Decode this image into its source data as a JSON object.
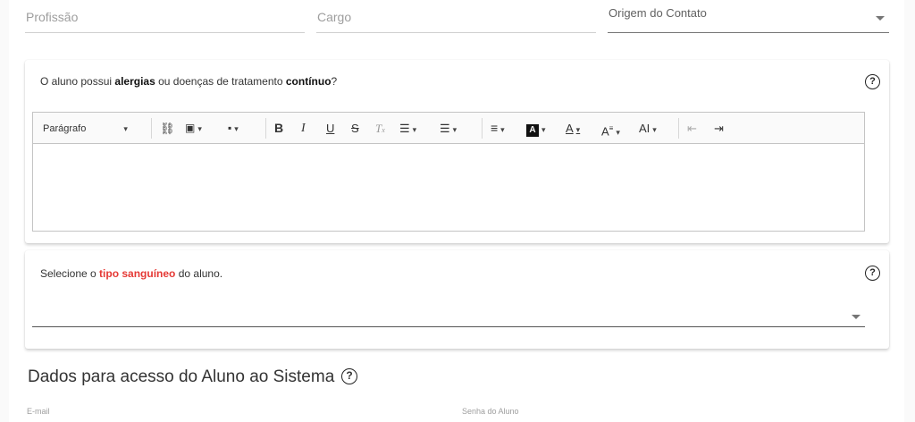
{
  "fields": {
    "profissao": "Profissão",
    "cargo": "Cargo",
    "origem": "Origem do Contato"
  },
  "allergy": {
    "text_before": "O aluno possui ",
    "bold1": "alergias",
    "text_mid": " ou doenças de tratamento ",
    "bold2": "contínuo",
    "text_after": "?",
    "help": "?"
  },
  "toolbar": {
    "paragraph": "Parágrafo",
    "items": [
      {
        "name": "link-icon",
        "glyph": "🔗"
      },
      {
        "name": "media-icon",
        "glyph": "▶"
      },
      {
        "name": "image-icon",
        "glyph": "🖼"
      },
      {
        "name": "bold-icon",
        "glyph": "B"
      },
      {
        "name": "italic-icon",
        "glyph": "I"
      },
      {
        "name": "underline-icon",
        "glyph": "U"
      },
      {
        "name": "strikethrough-icon",
        "glyph": "S"
      },
      {
        "name": "clear-format-icon",
        "glyph": "Tx"
      },
      {
        "name": "bulleted-list-icon",
        "glyph": "☰"
      },
      {
        "name": "numbered-list-icon",
        "glyph": "☰"
      },
      {
        "name": "align-icon",
        "glyph": "≡"
      },
      {
        "name": "background-color-icon",
        "glyph": "A"
      },
      {
        "name": "font-color-icon",
        "glyph": "A"
      },
      {
        "name": "font-family-icon",
        "glyph": "A"
      },
      {
        "name": "font-size-icon",
        "glyph": "AI"
      },
      {
        "name": "outdent-icon",
        "glyph": "⇤"
      },
      {
        "name": "indent-icon",
        "glyph": "⇥"
      }
    ]
  },
  "blood": {
    "text_before": "Selecione o ",
    "red": "tipo sanguíneo",
    "text_after": " do aluno.",
    "help": "?"
  },
  "access": {
    "title": "Dados para acesso do Aluno ao Sistema",
    "help": "?",
    "email_label": "E-mail",
    "password_label": "Senha do Aluno"
  },
  "colors": {
    "accent_red": "#e53935"
  }
}
